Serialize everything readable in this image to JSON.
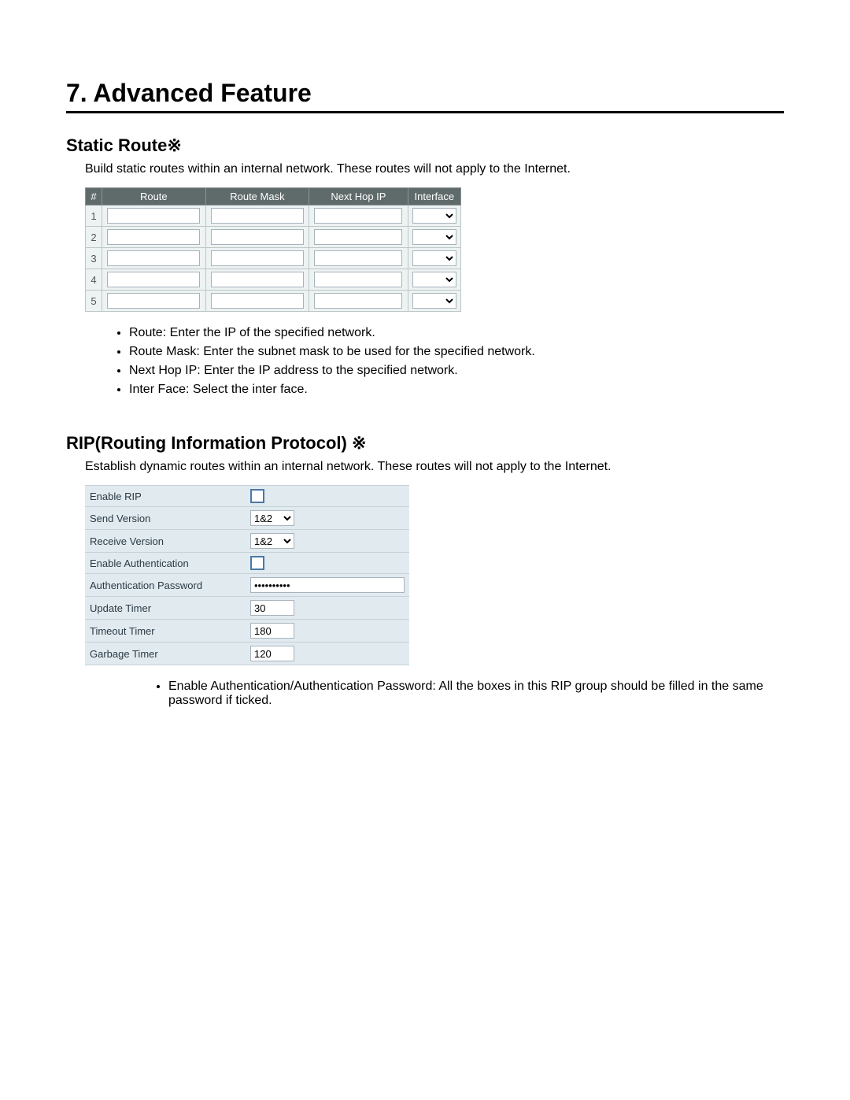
{
  "heading": "7.  Advanced Feature",
  "static_route": {
    "title": "Static Route※",
    "intro": "Build static routes within an internal network. These routes will not apply to the Internet.",
    "columns": {
      "num": "#",
      "route": "Route",
      "mask": "Route Mask",
      "hop": "Next Hop IP",
      "iface": "Interface"
    },
    "rows": [
      {
        "num": "1",
        "route": "",
        "mask": "",
        "hop": "",
        "iface": ""
      },
      {
        "num": "2",
        "route": "",
        "mask": "",
        "hop": "",
        "iface": ""
      },
      {
        "num": "3",
        "route": "",
        "mask": "",
        "hop": "",
        "iface": ""
      },
      {
        "num": "4",
        "route": "",
        "mask": "",
        "hop": "",
        "iface": ""
      },
      {
        "num": "5",
        "route": "",
        "mask": "",
        "hop": "",
        "iface": ""
      }
    ],
    "bullets": [
      "Route: Enter the IP of the specified network.",
      "Route Mask: Enter the subnet mask to be used for the specified network.",
      "Next Hop IP: Enter the IP address to the specified network.",
      "Inter Face: Select the inter face."
    ]
  },
  "rip": {
    "title": "RIP(Routing Information Protocol)  ※",
    "intro": "Establish dynamic routes within an internal network. These routes will not apply to the Internet.",
    "rows": {
      "enable_rip": {
        "label": "Enable RIP",
        "checked": false
      },
      "send_version": {
        "label": "Send Version",
        "value": "1&2"
      },
      "recv_version": {
        "label": "Receive Version",
        "value": "1&2"
      },
      "enable_auth": {
        "label": "Enable Authentication",
        "checked": false
      },
      "auth_pass": {
        "label": "Authentication Password",
        "value": "••••••••••"
      },
      "update_timer": {
        "label": "Update Timer",
        "value": "30"
      },
      "timeout_timer": {
        "label": "Timeout Timer",
        "value": "180"
      },
      "garbage_timer": {
        "label": "Garbage Timer",
        "value": "120"
      }
    },
    "bullets": [
      "Enable Authentication/Authentication Password: All the boxes in this RIP group should be filled in the same password if ticked."
    ]
  }
}
